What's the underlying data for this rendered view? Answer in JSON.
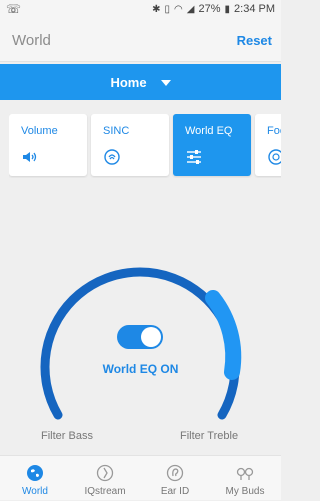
{
  "status_bar": {
    "left_icon": "headset-call-icon",
    "time": "2:34 PM",
    "battery": "27%",
    "icons": [
      "bluetooth-icon",
      "vibrate-icon",
      "wifi-icon",
      "signal-icon",
      "battery-icon"
    ]
  },
  "header": {
    "title": "World",
    "reset_label": "Reset"
  },
  "location": {
    "selected": "Home"
  },
  "tiles": [
    {
      "label": "Volume",
      "icon": "speaker-icon",
      "active": false
    },
    {
      "label": "SINC",
      "icon": "sinc-icon",
      "active": false
    },
    {
      "label": "World EQ",
      "icon": "equalizer-icon",
      "active": true
    },
    {
      "label": "Foc",
      "icon": "focus-icon",
      "active": false
    }
  ],
  "eq": {
    "status_text": "World EQ ON",
    "toggle_on": true,
    "filter_bass_label": "Filter Bass",
    "filter_treble_label": "Filter Treble"
  },
  "bottom_nav": [
    {
      "label": "World",
      "icon": "globe-icon",
      "active": true
    },
    {
      "label": "IQstream",
      "icon": "iqstream-icon",
      "active": false
    },
    {
      "label": "Ear ID",
      "icon": "ear-id-icon",
      "active": false
    },
    {
      "label": "My Buds",
      "icon": "earbuds-icon",
      "active": false
    }
  ],
  "colors": {
    "accent": "#1e88e5",
    "accent_light": "#1e96ee",
    "arc_dark": "#1565c0",
    "arc_highlight": "#2196f3",
    "background": "#efefef"
  }
}
